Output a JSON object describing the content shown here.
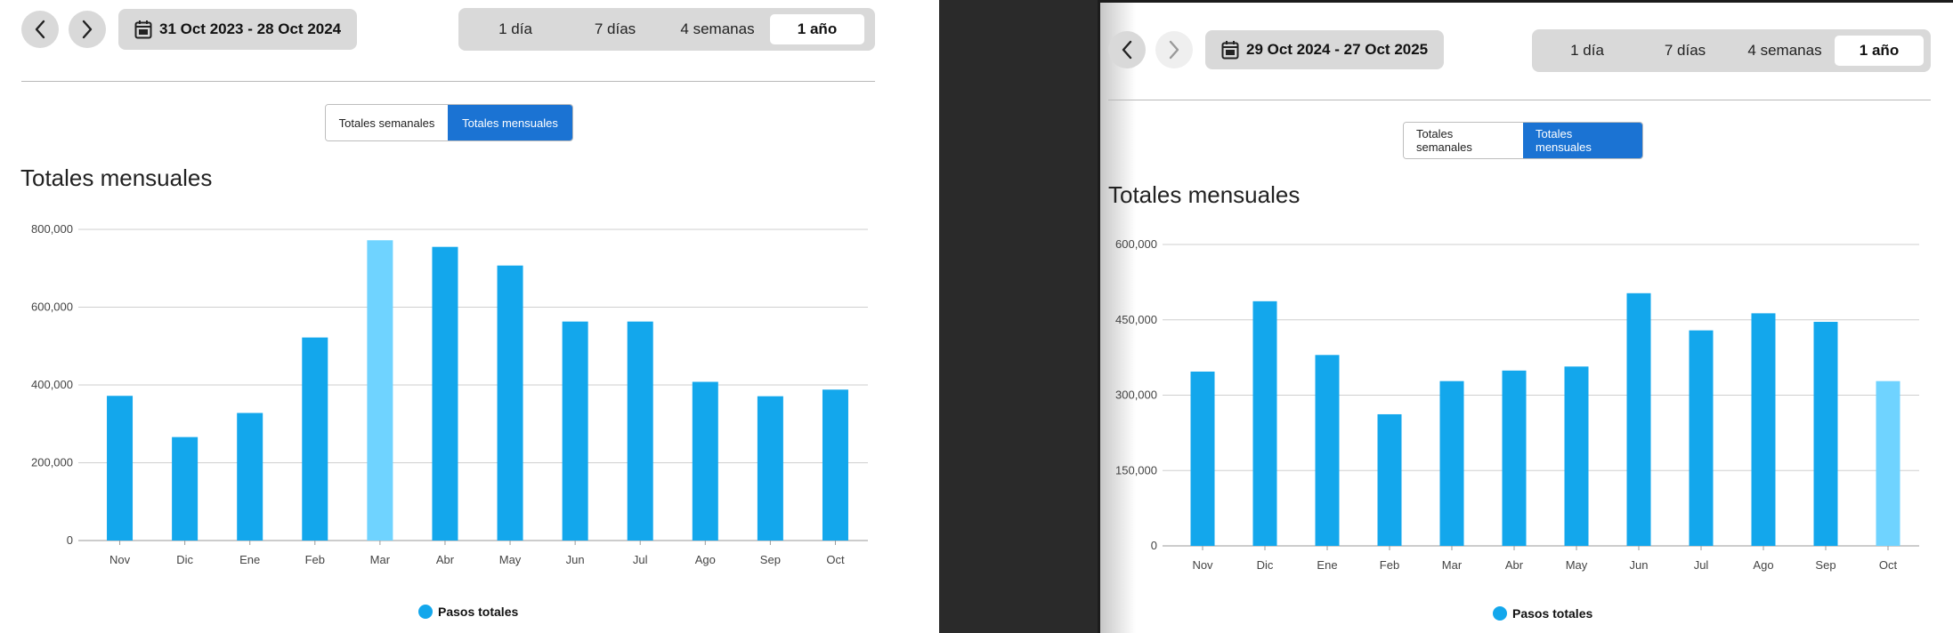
{
  "colors": {
    "bar": "#13a7ec",
    "bar_highlight": "#6fd3ff",
    "active_toggle": "#1b73d3"
  },
  "panels": [
    {
      "date_range": "31 Oct 2023 - 28 Oct 2024",
      "ranges": [
        "1 día",
        "7 días",
        "4 semanas",
        "1 año"
      ],
      "active_range": 3,
      "toggles": [
        "Totales semanales",
        "Totales mensuales"
      ],
      "active_toggle": 1,
      "title": "Totales mensuales",
      "legend": "Pasos totales"
    },
    {
      "date_range": "29 Oct 2024 - 27 Oct 2025",
      "ranges": [
        "1 día",
        "7 días",
        "4 semanas",
        "1 año"
      ],
      "active_range": 3,
      "toggles": [
        "Totales semanales",
        "Totales mensuales"
      ],
      "active_toggle": 1,
      "title": "Totales mensuales",
      "legend": "Pasos totales"
    }
  ],
  "chart_data": [
    {
      "type": "bar",
      "title": "Totales mensuales",
      "categories": [
        "Nov",
        "Dic",
        "Ene",
        "Feb",
        "Mar",
        "Abr",
        "May",
        "Jun",
        "Jul",
        "Ago",
        "Sep",
        "Oct"
      ],
      "series": [
        {
          "name": "Pasos totales",
          "values": [
            372000,
            266000,
            328000,
            522000,
            772000,
            755000,
            707000,
            563000,
            563000,
            408000,
            371000,
            388000
          ]
        }
      ],
      "highlight_index": 4,
      "ylim": [
        0,
        800000
      ],
      "yticks": [
        0,
        200000,
        400000,
        600000,
        800000
      ],
      "ytick_labels": [
        "0",
        "200,000",
        "400,000",
        "600,000",
        "800,000"
      ],
      "grid": true,
      "legend": "bottom-center"
    },
    {
      "type": "bar",
      "title": "Totales mensuales",
      "categories": [
        "Nov",
        "Dic",
        "Ene",
        "Feb",
        "Mar",
        "Abr",
        "May",
        "Jun",
        "Jul",
        "Ago",
        "Sep",
        "Oct"
      ],
      "series": [
        {
          "name": "Pasos totales",
          "values": [
            347000,
            487000,
            380000,
            262000,
            328000,
            349000,
            357000,
            503000,
            429000,
            463000,
            446000,
            328000
          ]
        }
      ],
      "highlight_index": 11,
      "ylim": [
        0,
        600000
      ],
      "yticks": [
        0,
        150000,
        300000,
        450000,
        600000
      ],
      "ytick_labels": [
        "0",
        "150,000",
        "300,000",
        "450,000",
        "600,000"
      ],
      "grid": true,
      "legend": "bottom-center"
    }
  ]
}
